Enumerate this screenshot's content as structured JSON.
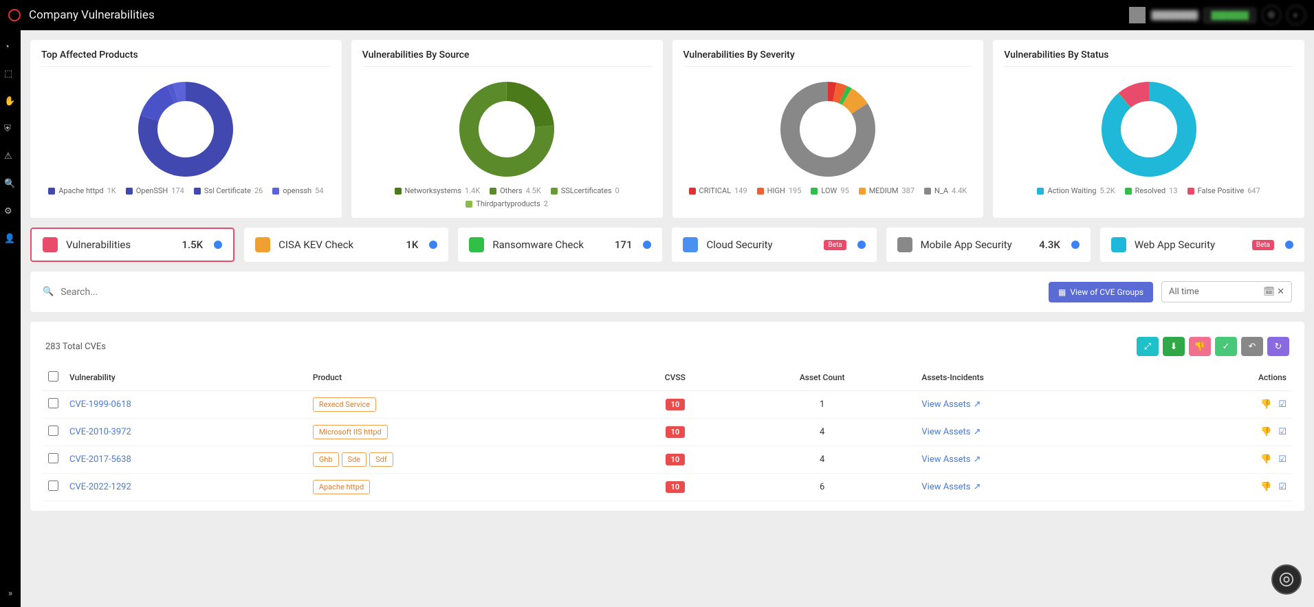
{
  "header": {
    "title": "Company Vulnerabilities",
    "user": "████████",
    "trial": "███████"
  },
  "charts": [
    {
      "title": "Top Affected Products",
      "legend": [
        {
          "c": "#4148b0",
          "l": "Apache httpd",
          "v": "1K"
        },
        {
          "c": "#4148b0",
          "l": "OpenSSH",
          "v": "174"
        },
        {
          "c": "#4148b0",
          "l": "Ssl Certificate",
          "v": "26"
        },
        {
          "c": "#5b63d8",
          "l": "openssh",
          "v": "54"
        }
      ]
    },
    {
      "title": "Vulnerabilities By Source",
      "legend": [
        {
          "c": "#4a7a1a",
          "l": "Networksystems",
          "v": "1.4K"
        },
        {
          "c": "#5a8a2a",
          "l": "Others",
          "v": "4.5K"
        },
        {
          "c": "#6a9a3a",
          "l": "SSLcertificates",
          "v": "0"
        },
        {
          "c": "#8aba4a",
          "l": "Thirdpartyproducts",
          "v": "2"
        }
      ]
    },
    {
      "title": "Vulnerabilities By Severity",
      "legend": [
        {
          "c": "#e03030",
          "l": "CRITICAL",
          "v": "149"
        },
        {
          "c": "#f06030",
          "l": "HIGH",
          "v": "195"
        },
        {
          "c": "#30c048",
          "l": "LOW",
          "v": "95"
        },
        {
          "c": "#f0a030",
          "l": "MEDIUM",
          "v": "387"
        },
        {
          "c": "#888",
          "l": "N_A",
          "v": "4.4K"
        }
      ]
    },
    {
      "title": "Vulnerabilities By Status",
      "legend": [
        {
          "c": "#20b8d8",
          "l": "Action Waiting",
          "v": "5.2K"
        },
        {
          "c": "#30c048",
          "l": "Resolved",
          "v": "13"
        },
        {
          "c": "#e84c6a",
          "l": "False Positive",
          "v": "647"
        }
      ]
    }
  ],
  "chart_data": [
    {
      "type": "pie",
      "title": "Top Affected Products",
      "series": [
        {
          "name": "Apache httpd",
          "value": 1000,
          "color": "#4148b0"
        },
        {
          "name": "OpenSSH",
          "value": 174,
          "color": "#4a52c8"
        },
        {
          "name": "Ssl Certificate",
          "value": 26,
          "color": "#5058d0"
        },
        {
          "name": "openssh",
          "value": 54,
          "color": "#5b63d8"
        }
      ]
    },
    {
      "type": "pie",
      "title": "Vulnerabilities By Source",
      "series": [
        {
          "name": "Networksystems",
          "value": 1400,
          "color": "#4a7a1a"
        },
        {
          "name": "Others",
          "value": 4500,
          "color": "#5a8a2a"
        },
        {
          "name": "SSLcertificates",
          "value": 0,
          "color": "#6a9a3a"
        },
        {
          "name": "Thirdpartyproducts",
          "value": 2,
          "color": "#8aba4a"
        }
      ]
    },
    {
      "type": "pie",
      "title": "Vulnerabilities By Severity",
      "series": [
        {
          "name": "CRITICAL",
          "value": 149,
          "color": "#e03030"
        },
        {
          "name": "HIGH",
          "value": 195,
          "color": "#f06030"
        },
        {
          "name": "LOW",
          "value": 95,
          "color": "#30c048"
        },
        {
          "name": "MEDIUM",
          "value": 387,
          "color": "#f0a030"
        },
        {
          "name": "N_A",
          "value": 4400,
          "color": "#888"
        }
      ]
    },
    {
      "type": "pie",
      "title": "Vulnerabilities By Status",
      "series": [
        {
          "name": "Action Waiting",
          "value": 5200,
          "color": "#20b8d8"
        },
        {
          "name": "Resolved",
          "value": 13,
          "color": "#30c048"
        },
        {
          "name": "False Positive",
          "value": 647,
          "color": "#e84c6a"
        }
      ]
    }
  ],
  "tabs": [
    {
      "color": "#e84c6a",
      "label": "Vulnerabilities",
      "value": "1.5K",
      "active": true
    },
    {
      "color": "#f0a030",
      "label": "CISA KEV Check",
      "value": "1K"
    },
    {
      "color": "#30c048",
      "label": "Ransomware Check",
      "value": "171"
    },
    {
      "color": "#4a90f0",
      "label": "Cloud Security",
      "beta": "Beta"
    },
    {
      "color": "#888",
      "label": "Mobile App Security",
      "value": "4.3K"
    },
    {
      "color": "#20b8d8",
      "label": "Web App Security",
      "beta": "Beta"
    }
  ],
  "search": {
    "placeholder": "Search...",
    "cveBtn": "View of CVE Groups",
    "dateRange": "All time"
  },
  "table": {
    "total": "283 Total CVEs",
    "cols": {
      "sel": "",
      "vuln": "Vulnerability",
      "prod": "Product",
      "cvss": "CVSS",
      "assets": "Asset Count",
      "ai": "Assets-Incidents",
      "act": "Actions"
    },
    "viewAssets": "View Assets",
    "rows": [
      {
        "cve": "CVE-1999-0618",
        "products": [
          "Rexecd Service"
        ],
        "cvss": "10",
        "assets": "1"
      },
      {
        "cve": "CVE-2010-3972",
        "products": [
          "Microsoft IIS httpd"
        ],
        "cvss": "10",
        "assets": "4"
      },
      {
        "cve": "CVE-2017-5638",
        "products": [
          "Ghb",
          "Sde",
          "Sdf"
        ],
        "cvss": "10",
        "assets": "4"
      },
      {
        "cve": "CVE-2022-1292",
        "products": [
          "Apache httpd"
        ],
        "cvss": "10",
        "assets": "6"
      }
    ]
  }
}
